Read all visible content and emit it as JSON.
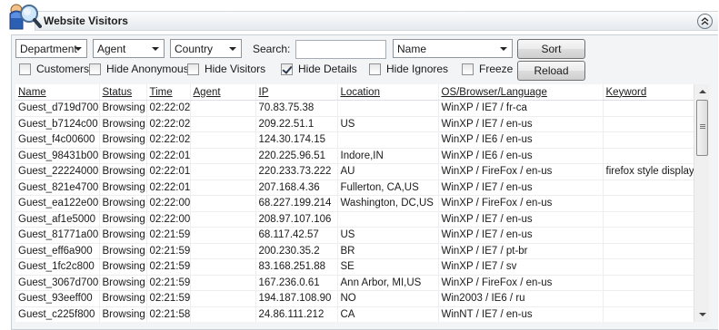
{
  "header": {
    "title": "Website Visitors"
  },
  "toolbar": {
    "department_select": "Department",
    "agent_select": "Agent",
    "country_select": "Country",
    "search_label": "Search:",
    "search_value": "",
    "sort_field_select": "Name",
    "sort_button": "Sort",
    "reload_button": "Reload"
  },
  "filters": [
    {
      "label": "Customers",
      "checked": false
    },
    {
      "label": "Hide Anonymous",
      "checked": false
    },
    {
      "label": "Hide Visitors",
      "checked": false
    },
    {
      "label": "Hide Details",
      "checked": true
    },
    {
      "label": "Hide Ignores",
      "checked": false
    },
    {
      "label": "Freeze",
      "checked": false
    }
  ],
  "table": {
    "columns": [
      "Name",
      "Status",
      "Time",
      "Agent",
      "IP",
      "Location",
      "OS/Browser/Language",
      "Keyword"
    ],
    "rows": [
      [
        "Guest_d719d700",
        "Browsing",
        "02:22:02",
        "",
        "70.83.75.38",
        "",
        "WinXP / IE7 / fr-ca",
        ""
      ],
      [
        "Guest_b7124c00",
        "Browsing",
        "02:22:02",
        "",
        "209.22.51.1",
        "US",
        "WinXP / IE7 / en-us",
        ""
      ],
      [
        "Guest_f4c00600",
        "Browsing",
        "02:22:02",
        "",
        "124.30.174.15",
        "",
        "WinXP / IE6 / en-us",
        ""
      ],
      [
        "Guest_98431b00",
        "Browsing",
        "02:22:01",
        "",
        "220.225.96.51",
        "Indore,IN",
        "WinXP / IE6 / en-us",
        ""
      ],
      [
        "Guest_22224000",
        "Browsing",
        "02:22:01",
        "",
        "220.233.73.222",
        "AU",
        "WinXP / FireFox / en-us",
        "firefox style display"
      ],
      [
        "Guest_821e4700",
        "Browsing",
        "02:22:01",
        "",
        "207.168.4.36",
        "Fullerton, CA,US",
        "WinXP / IE7 / en-us",
        ""
      ],
      [
        "Guest_ea122e00",
        "Browsing",
        "02:22:00",
        "",
        "68.227.199.214",
        "Washington, DC,US",
        "WinXP / FireFox / en-us",
        ""
      ],
      [
        "Guest_af1e5000",
        "Browsing",
        "02:22:00",
        "",
        "208.97.107.106",
        "",
        "WinXP / IE7 / en-us",
        ""
      ],
      [
        "Guest_81771a00",
        "Browsing",
        "02:21:59",
        "",
        "68.117.42.57",
        "US",
        "WinXP / IE7 / en-us",
        ""
      ],
      [
        "Guest_eff6a900",
        "Browsing",
        "02:21:59",
        "",
        "200.230.35.2",
        "BR",
        "WinXP / IE7 / pt-br",
        ""
      ],
      [
        "Guest_1fc2c800",
        "Browsing",
        "02:21:59",
        "",
        "83.168.251.88",
        "SE",
        "WinXP / IE7 / sv",
        ""
      ],
      [
        "Guest_3067d700",
        "Browsing",
        "02:21:59",
        "",
        "167.236.0.61",
        "Ann Arbor, MI,US",
        "WinXP / FireFox / en-us",
        ""
      ],
      [
        "Guest_93eeff00",
        "Browsing",
        "02:21:59",
        "",
        "194.187.108.90",
        "NO",
        "Win2003 / IE6 / ru",
        ""
      ],
      [
        "Guest_c225f800",
        "Browsing",
        "02:21:58",
        "",
        "24.86.111.212",
        "CA",
        "WinNT / IE7 / en-us",
        ""
      ]
    ]
  },
  "colors": {
    "panel_bg": "#f3f4f6",
    "header_bar": "#e6eaee",
    "border": "#c9ced4"
  },
  "icons": {
    "logo": "visitor-magnifier-icon",
    "collapse": "double-chevron-up-icon"
  }
}
